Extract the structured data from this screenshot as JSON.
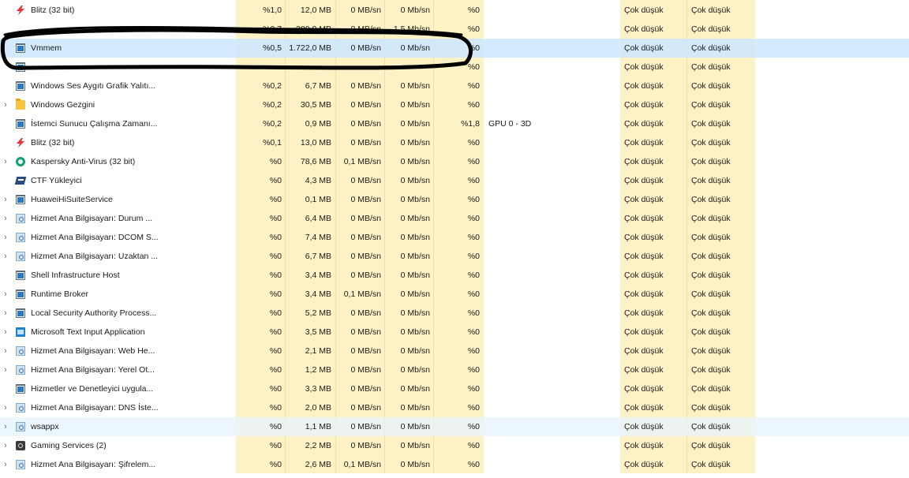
{
  "rows": [
    {
      "name": "Blitz (32 bit)",
      "icon": "blitz-bolt-icon",
      "expand": false,
      "cpu": "%1,0",
      "mem": "12,0 MB",
      "disk": "0 MB/sn",
      "net": "0 Mb/sn",
      "gpu": "%0",
      "eng": "",
      "pow": "Çok düşük",
      "pow2": "Çok düşük",
      "state": ""
    },
    {
      "name": "",
      "icon": "",
      "expand": false,
      "cpu": "%0,7",
      "mem": "280,0 MB",
      "disk": "0 MB/sn",
      "net": "1,5 Mb/sn",
      "gpu": "%0",
      "eng": "",
      "pow": "Çok düşük",
      "pow2": "Çok düşük",
      "state": ""
    },
    {
      "name": "Vmmem",
      "icon": "window-icon",
      "expand": false,
      "cpu": "%0,5",
      "mem": "1.722,0 MB",
      "disk": "0 MB/sn",
      "net": "0 Mb/sn",
      "gpu": "%0",
      "eng": "",
      "pow": "Çok düşük",
      "pow2": "Çok düşük",
      "state": "sel"
    },
    {
      "name": "",
      "icon": "window-icon",
      "expand": false,
      "cpu": "",
      "mem": "",
      "disk": "",
      "net": "",
      "gpu": "%0",
      "eng": "",
      "pow": "Çok düşük",
      "pow2": "Çok düşük",
      "state": ""
    },
    {
      "name": "Windows Ses Aygıtı Grafik Yalıtı...",
      "icon": "window-icon",
      "expand": false,
      "cpu": "%0,2",
      "mem": "6,7 MB",
      "disk": "0 MB/sn",
      "net": "0 Mb/sn",
      "gpu": "%0",
      "eng": "",
      "pow": "Çok düşük",
      "pow2": "Çok düşük",
      "state": ""
    },
    {
      "name": "Windows Gezgini",
      "icon": "folder-icon",
      "expand": true,
      "cpu": "%0,2",
      "mem": "30,5 MB",
      "disk": "0 MB/sn",
      "net": "0 Mb/sn",
      "gpu": "%0",
      "eng": "",
      "pow": "Çok düşük",
      "pow2": "Çok düşük",
      "state": ""
    },
    {
      "name": "İstemci Sunucu Çalışma Zamanı...",
      "icon": "window-icon",
      "expand": false,
      "cpu": "%0,2",
      "mem": "0,9 MB",
      "disk": "0 MB/sn",
      "net": "0 Mb/sn",
      "gpu": "%1,8",
      "eng": "GPU 0 - 3D",
      "pow": "Çok düşük",
      "pow2": "Çok düşük",
      "state": ""
    },
    {
      "name": "Blitz (32 bit)",
      "icon": "blitz-bolt-icon",
      "expand": false,
      "cpu": "%0,1",
      "mem": "13,0 MB",
      "disk": "0 MB/sn",
      "net": "0 Mb/sn",
      "gpu": "%0",
      "eng": "",
      "pow": "Çok düşük",
      "pow2": "Çok düşük",
      "state": ""
    },
    {
      "name": "Kaspersky Anti-Virus (32 bit)",
      "icon": "kaspersky-icon",
      "expand": true,
      "cpu": "%0",
      "mem": "78,6 MB",
      "disk": "0,1 MB/sn",
      "net": "0 Mb/sn",
      "gpu": "%0",
      "eng": "",
      "pow": "Çok düşük",
      "pow2": "Çok düşük",
      "state": ""
    },
    {
      "name": "CTF Yükleyici",
      "icon": "ctf-icon",
      "expand": false,
      "cpu": "%0",
      "mem": "4,3 MB",
      "disk": "0 MB/sn",
      "net": "0 Mb/sn",
      "gpu": "%0",
      "eng": "",
      "pow": "Çok düşük",
      "pow2": "Çok düşük",
      "state": ""
    },
    {
      "name": "HuaweiHiSuiteService",
      "icon": "window-icon",
      "expand": true,
      "cpu": "%0",
      "mem": "0,1 MB",
      "disk": "0 MB/sn",
      "net": "0 Mb/sn",
      "gpu": "%0",
      "eng": "",
      "pow": "Çok düşük",
      "pow2": "Çok düşük",
      "state": ""
    },
    {
      "name": "Hizmet Ana Bilgisayarı: Durum ...",
      "icon": "service-gear-icon",
      "expand": true,
      "cpu": "%0",
      "mem": "6,4 MB",
      "disk": "0 MB/sn",
      "net": "0 Mb/sn",
      "gpu": "%0",
      "eng": "",
      "pow": "Çok düşük",
      "pow2": "Çok düşük",
      "state": ""
    },
    {
      "name": "Hizmet Ana Bilgisayarı: DCOM S...",
      "icon": "service-gear-icon",
      "expand": true,
      "cpu": "%0",
      "mem": "7,4 MB",
      "disk": "0 MB/sn",
      "net": "0 Mb/sn",
      "gpu": "%0",
      "eng": "",
      "pow": "Çok düşük",
      "pow2": "Çok düşük",
      "state": ""
    },
    {
      "name": "Hizmet Ana Bilgisayarı: Uzaktan ...",
      "icon": "service-gear-icon",
      "expand": true,
      "cpu": "%0",
      "mem": "6,7 MB",
      "disk": "0 MB/sn",
      "net": "0 Mb/sn",
      "gpu": "%0",
      "eng": "",
      "pow": "Çok düşük",
      "pow2": "Çok düşük",
      "state": ""
    },
    {
      "name": "Shell Infrastructure Host",
      "icon": "window-icon",
      "expand": false,
      "cpu": "%0",
      "mem": "3,4 MB",
      "disk": "0 MB/sn",
      "net": "0 Mb/sn",
      "gpu": "%0",
      "eng": "",
      "pow": "Çok düşük",
      "pow2": "Çok düşük",
      "state": ""
    },
    {
      "name": "Runtime Broker",
      "icon": "window-icon",
      "expand": true,
      "cpu": "%0",
      "mem": "3,4 MB",
      "disk": "0,1 MB/sn",
      "net": "0 Mb/sn",
      "gpu": "%0",
      "eng": "",
      "pow": "Çok düşük",
      "pow2": "Çok düşük",
      "state": ""
    },
    {
      "name": "Local Security Authority Process...",
      "icon": "window-icon",
      "expand": true,
      "cpu": "%0",
      "mem": "5,2 MB",
      "disk": "0 MB/sn",
      "net": "0 Mb/sn",
      "gpu": "%0",
      "eng": "",
      "pow": "Çok düşük",
      "pow2": "Çok düşük",
      "state": ""
    },
    {
      "name": "Microsoft Text Input Application",
      "icon": "text-input-app-icon",
      "expand": true,
      "cpu": "%0",
      "mem": "3,5 MB",
      "disk": "0 MB/sn",
      "net": "0 Mb/sn",
      "gpu": "%0",
      "eng": "",
      "pow": "Çok düşük",
      "pow2": "Çok düşük",
      "state": ""
    },
    {
      "name": "Hizmet Ana Bilgisayarı: Web He...",
      "icon": "service-gear-icon",
      "expand": true,
      "cpu": "%0",
      "mem": "2,1 MB",
      "disk": "0 MB/sn",
      "net": "0 Mb/sn",
      "gpu": "%0",
      "eng": "",
      "pow": "Çok düşük",
      "pow2": "Çok düşük",
      "state": ""
    },
    {
      "name": "Hizmet Ana Bilgisayarı: Yerel Ot...",
      "icon": "service-gear-icon",
      "expand": true,
      "cpu": "%0",
      "mem": "1,2 MB",
      "disk": "0 MB/sn",
      "net": "0 Mb/sn",
      "gpu": "%0",
      "eng": "",
      "pow": "Çok düşük",
      "pow2": "Çok düşük",
      "state": ""
    },
    {
      "name": "Hizmetler ve Denetleyici uygula...",
      "icon": "window-icon",
      "expand": false,
      "cpu": "%0",
      "mem": "3,3 MB",
      "disk": "0 MB/sn",
      "net": "0 Mb/sn",
      "gpu": "%0",
      "eng": "",
      "pow": "Çok düşük",
      "pow2": "Çok düşük",
      "state": ""
    },
    {
      "name": "Hizmet Ana Bilgisayarı: DNS İste...",
      "icon": "service-gear-icon",
      "expand": true,
      "cpu": "%0",
      "mem": "2,0 MB",
      "disk": "0 MB/sn",
      "net": "0 Mb/sn",
      "gpu": "%0",
      "eng": "",
      "pow": "Çok düşük",
      "pow2": "Çok düşük",
      "state": ""
    },
    {
      "name": "wsappx",
      "icon": "service-gear-icon",
      "expand": true,
      "cpu": "%0",
      "mem": "1,1 MB",
      "disk": "0 MB/sn",
      "net": "0 Mb/sn",
      "gpu": "%0",
      "eng": "",
      "pow": "Çok düşük",
      "pow2": "Çok düşük",
      "state": "hov"
    },
    {
      "name": "Gaming Services (2)",
      "icon": "xbox-icon",
      "expand": true,
      "cpu": "%0",
      "mem": "2,2 MB",
      "disk": "0 MB/sn",
      "net": "0 Mb/sn",
      "gpu": "%0",
      "eng": "",
      "pow": "Çok düşük",
      "pow2": "Çok düşük",
      "state": ""
    },
    {
      "name": "Hizmet Ana Bilgisayarı: Şifrelem...",
      "icon": "service-gear-icon",
      "expand": true,
      "cpu": "%0",
      "mem": "2,6 MB",
      "disk": "0,1 MB/sn",
      "net": "0 Mb/sn",
      "gpu": "%0",
      "eng": "",
      "pow": "Çok düşük",
      "pow2": "Çok düşük",
      "state": ""
    }
  ],
  "colors": {
    "heat_yellow": "#fdf2c6",
    "selected_row": "#cce8ff",
    "annotation_ink": "#000000"
  }
}
